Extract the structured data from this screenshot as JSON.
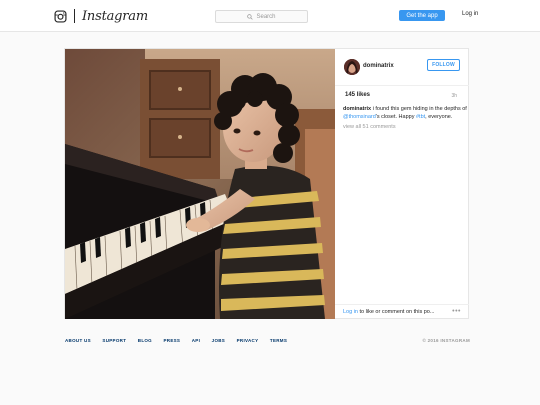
{
  "nav": {
    "wordmark": "Instagram",
    "search_placeholder": "Search",
    "get_app": "Get the app",
    "login": "Log in"
  },
  "post": {
    "username": "dominatrix",
    "follow_label": "FOLLOW",
    "likes": "145 likes",
    "time": "3h",
    "caption_user": "dominatrix",
    "caption_part1": " i found this gem hiding in the depths of ",
    "caption_mention": "@thomsinard",
    "caption_part2": "'s closet. Happy ",
    "caption_tag": "#tbt",
    "caption_part3": ", everyone.",
    "view_all": "view all 51 comments",
    "login_link": "Log in",
    "comment_prompt": " to like or comment on this po...",
    "more": "•••"
  },
  "footer": {
    "links": [
      "ABOUT US",
      "SUPPORT",
      "BLOG",
      "PRESS",
      "API",
      "JOBS",
      "PRIVACY",
      "TERMS"
    ],
    "copyright": "© 2016 INSTAGRAM"
  },
  "colors": {
    "accent": "#3897f0",
    "footer_link": "#003569"
  },
  "icons": {
    "logo": "instagram-camera-icon",
    "search": "search-icon",
    "more": "more-options-icon"
  }
}
